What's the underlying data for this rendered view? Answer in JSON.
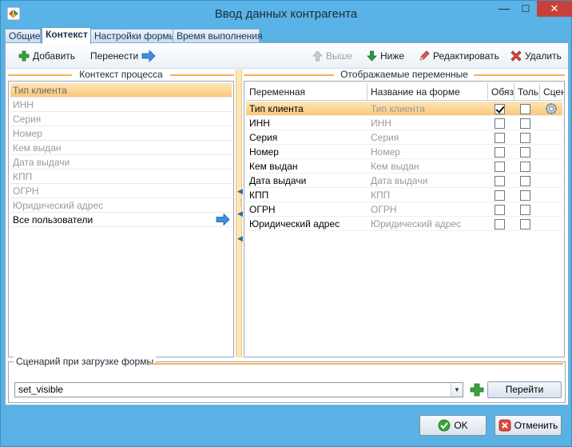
{
  "window": {
    "title": "Ввод данных контрагента",
    "min_glyph": "—",
    "max_glyph": "☐",
    "close_glyph": "✕"
  },
  "tabs": [
    {
      "label": "Общие",
      "active": false
    },
    {
      "label": "Контекст",
      "active": true
    },
    {
      "label": "Настройки формы",
      "active": false
    },
    {
      "label": "Время выполнения",
      "active": false
    }
  ],
  "toolbar": {
    "add_label": "Добавить",
    "move_label": "Перенести",
    "up_label": "Выше",
    "down_label": "Ниже",
    "edit_label": "Редактировать",
    "delete_label": "Удалить"
  },
  "context_panel": {
    "title": "Контекст процесса",
    "items": [
      {
        "label": "Тип клиента",
        "state": "selected"
      },
      {
        "label": "ИНН",
        "state": "used"
      },
      {
        "label": "Серия",
        "state": "used"
      },
      {
        "label": "Номер",
        "state": "used"
      },
      {
        "label": "Кем выдан",
        "state": "used"
      },
      {
        "label": "Дата выдачи",
        "state": "used"
      },
      {
        "label": "КПП",
        "state": "used"
      },
      {
        "label": "ОГРН",
        "state": "used"
      },
      {
        "label": "Юридический адрес",
        "state": "used"
      },
      {
        "label": "Все пользователи",
        "state": "active"
      }
    ]
  },
  "displayed_panel": {
    "title": "Отображаемые переменные",
    "columns": [
      "Переменная",
      "Название на форме",
      "Обяз",
      "Толь",
      "Сцен"
    ],
    "rows": [
      {
        "variable": "Тип клиента",
        "form_name": "Тип клиента",
        "required": true,
        "readonly": false,
        "scenario": true,
        "selected": true
      },
      {
        "variable": "ИНН",
        "form_name": "ИНН",
        "required": false,
        "readonly": false,
        "scenario": false,
        "selected": false
      },
      {
        "variable": "Серия",
        "form_name": "Серия",
        "required": false,
        "readonly": false,
        "scenario": false,
        "selected": false
      },
      {
        "variable": "Номер",
        "form_name": "Номер",
        "required": false,
        "readonly": false,
        "scenario": false,
        "selected": false
      },
      {
        "variable": "Кем выдан",
        "form_name": "Кем выдан",
        "required": false,
        "readonly": false,
        "scenario": false,
        "selected": false
      },
      {
        "variable": "Дата выдачи",
        "form_name": "Дата выдачи",
        "required": false,
        "readonly": false,
        "scenario": false,
        "selected": false
      },
      {
        "variable": "КПП",
        "form_name": "КПП",
        "required": false,
        "readonly": false,
        "scenario": false,
        "selected": false
      },
      {
        "variable": "ОГРН",
        "form_name": "ОГРН",
        "required": false,
        "readonly": false,
        "scenario": false,
        "selected": false
      },
      {
        "variable": "Юридический адрес",
        "form_name": "Юридический адрес",
        "required": false,
        "readonly": false,
        "scenario": false,
        "selected": false
      }
    ]
  },
  "scenario": {
    "title": "Сценарий при загрузке формы",
    "value": "set_visible",
    "goto_label": "Перейти"
  },
  "buttons": {
    "ok_label": "OK",
    "cancel_label": "Отменить"
  },
  "colors": {
    "window_frame": "#59b1e4",
    "selection": "#fbc77a",
    "close_button": "#c7413a",
    "accent_arrow": "#2f7ed8"
  }
}
